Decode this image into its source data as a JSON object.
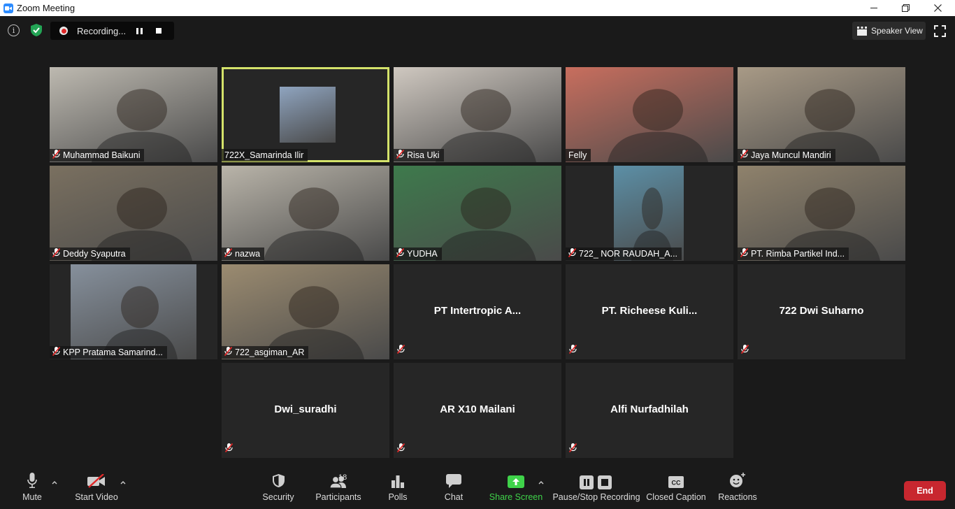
{
  "window": {
    "title": "Zoom Meeting"
  },
  "topbar": {
    "recording_label": "Recording...",
    "view_label": "Speaker View"
  },
  "participants": [
    {
      "name": "Muhammad Baikuni",
      "muted": true,
      "video": true
    },
    {
      "name": "722X_Samarinda Ilir",
      "muted": false,
      "video": true,
      "active_speaker": true
    },
    {
      "name": "Risa Uki",
      "muted": true,
      "video": true
    },
    {
      "name": "Felly",
      "muted": false,
      "video": true
    },
    {
      "name": "Jaya Muncul Mandiri",
      "muted": true,
      "video": true
    },
    {
      "name": "Deddy Syaputra",
      "muted": true,
      "video": true
    },
    {
      "name": "nazwa",
      "muted": true,
      "video": true
    },
    {
      "name": "YUDHA",
      "muted": true,
      "video": true
    },
    {
      "name": "722_ NOR RAUDAH_A...",
      "muted": true,
      "video": true
    },
    {
      "name": "PT. Rimba Partikel Ind...",
      "muted": true,
      "video": true
    },
    {
      "name": "KPP Pratama Samarind...",
      "muted": true,
      "video": true
    },
    {
      "name": "722_asgiman_AR",
      "muted": true,
      "video": true
    },
    {
      "name": "PT Intertropic A...",
      "muted": true,
      "video": false
    },
    {
      "name": "PT. Richeese  Kuli...",
      "muted": true,
      "video": false
    },
    {
      "name": "722 Dwi Suharno",
      "muted": true,
      "video": false
    },
    {
      "name": "Dwi_suradhi",
      "muted": true,
      "video": false
    },
    {
      "name": "AR X10 Mailani",
      "muted": true,
      "video": false
    },
    {
      "name": "Alfi Nurfadhilah",
      "muted": true,
      "video": false
    }
  ],
  "video_backgrounds": [
    "#bdb9b0",
    "#8fa4bf",
    "#cfc8c0",
    "#c86e5e",
    "#a89a86",
    "#7a7060",
    "#b9b4a9",
    "#3e7a4c",
    "#5c8fa6",
    "#8f826c",
    "#86909c",
    "#9b8b70"
  ],
  "toolbar": {
    "mute": "Mute",
    "start_video": "Start Video",
    "security": "Security",
    "participants": "Participants",
    "participants_count": "18",
    "polls": "Polls",
    "chat": "Chat",
    "share_screen": "Share Screen",
    "record": "Pause/Stop Recording",
    "closed_caption": "Closed Caption",
    "cc_glyph": "CC",
    "reactions": "Reactions",
    "end": "End"
  },
  "colors": {
    "share_green": "#3fd34a",
    "end_red": "#c8272f",
    "active_outline": "#d4e26a",
    "muted_red": "#e02828"
  }
}
